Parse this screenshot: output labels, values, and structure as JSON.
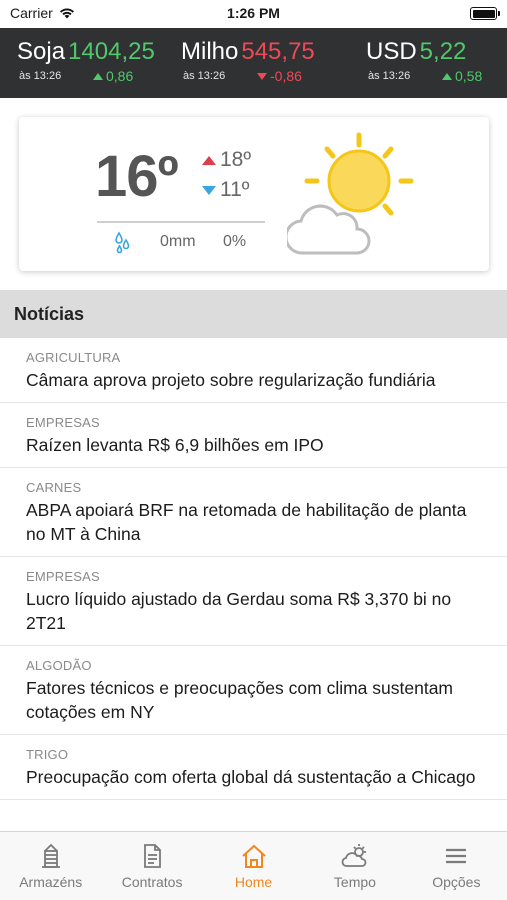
{
  "status_bar": {
    "carrier": "Carrier",
    "time": "1:26 PM"
  },
  "ticker": [
    {
      "name": "Soja",
      "price": "1404,25",
      "time": "às 13:26",
      "change": "0,86",
      "direction": "up"
    },
    {
      "name": "Milho",
      "price": "545,75",
      "time": "às 13:26",
      "change": "-0,86",
      "direction": "down"
    },
    {
      "name": "USD",
      "price": "5,22",
      "time": "às 13:26",
      "change": "0,58",
      "direction": "up"
    }
  ],
  "weather": {
    "temperature": "16º",
    "max": "18º",
    "min": "11º",
    "rain": "0mm",
    "rain_chance": "0%",
    "icon": "partly-cloudy-icon"
  },
  "news": {
    "header": "Notícias",
    "items": [
      {
        "category": "AGRICULTURA",
        "title": "Câmara aprova projeto sobre regularização fundiária"
      },
      {
        "category": "EMPRESAS",
        "title": "Raízen levanta R$ 6,9 bilhões em IPO"
      },
      {
        "category": "CARNES",
        "title": "ABPA apoiará BRF na retomada de habilitação de planta no MT à China"
      },
      {
        "category": "EMPRESAS",
        "title": "Lucro líquido ajustado da Gerdau soma R$ 3,370 bi no 2T21"
      },
      {
        "category": "ALGODÃO",
        "title": "Fatores técnicos e preocupações com clima sustentam cotações em NY"
      },
      {
        "category": "TRIGO",
        "title": "Preocupação com oferta global dá sustentação a Chicago"
      }
    ]
  },
  "tabs": [
    {
      "label": "Armazéns",
      "icon": "silo-icon"
    },
    {
      "label": "Contratos",
      "icon": "document-icon"
    },
    {
      "label": "Home",
      "icon": "home-icon",
      "active": true
    },
    {
      "label": "Tempo",
      "icon": "weather-icon"
    },
    {
      "label": "Opções",
      "icon": "menu-icon"
    }
  ],
  "colors": {
    "up": "#4fc96a",
    "down": "#ee4a55",
    "accent": "#f0871f",
    "ticker_bg": "#2f3133"
  }
}
